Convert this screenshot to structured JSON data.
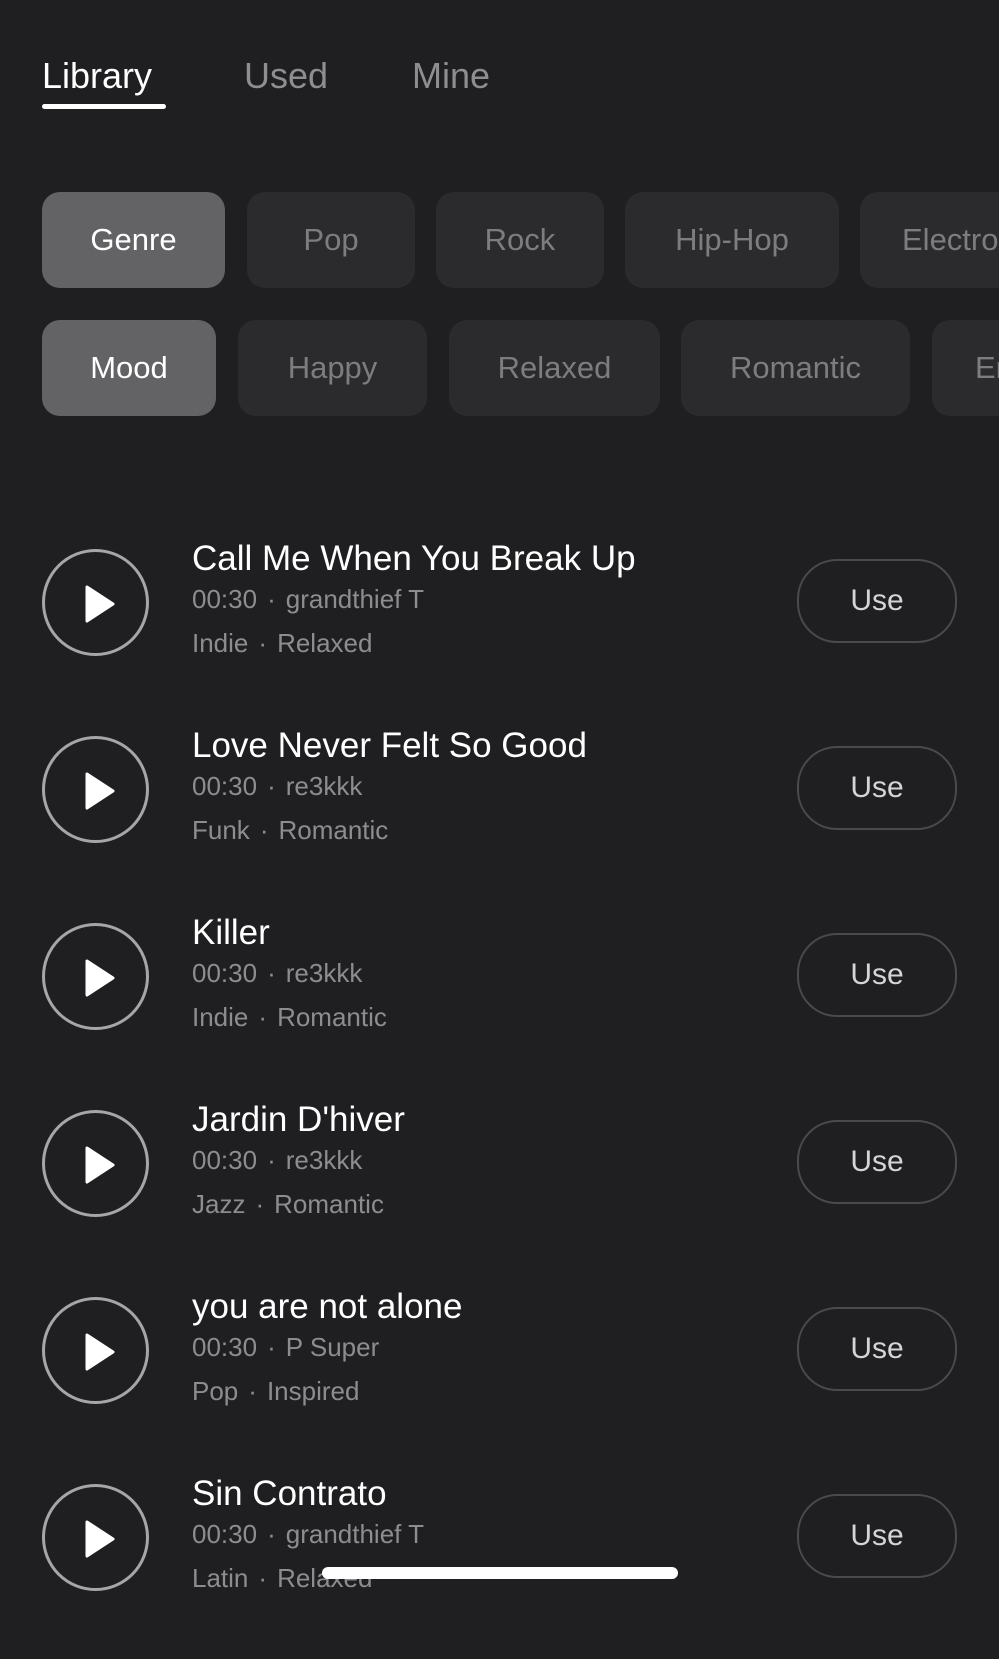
{
  "tabs": [
    {
      "label": "Library",
      "active": true
    },
    {
      "label": "Used",
      "active": false
    },
    {
      "label": "Mine",
      "active": false
    }
  ],
  "filters": {
    "genre": {
      "label": "Genre",
      "options": [
        "Pop",
        "Rock",
        "Hip-Hop",
        "Electro"
      ]
    },
    "mood": {
      "label": "Mood",
      "options": [
        "Happy",
        "Relaxed",
        "Romantic",
        "En"
      ]
    }
  },
  "songs": [
    {
      "title": "Call Me When You Break Up",
      "duration": "00:30",
      "artist": "grandthief T",
      "genre": "Indie",
      "mood": "Relaxed",
      "action": "Use"
    },
    {
      "title": "Love Never Felt So Good",
      "duration": "00:30",
      "artist": "re3kkk",
      "genre": "Funk",
      "mood": "Romantic",
      "action": "Use"
    },
    {
      "title": "Killer",
      "duration": "00:30",
      "artist": "re3kkk",
      "genre": "Indie",
      "mood": "Romantic",
      "action": "Use"
    },
    {
      "title": "Jardin D'hiver",
      "duration": "00:30",
      "artist": "re3kkk",
      "genre": "Jazz",
      "mood": "Romantic",
      "action": "Use"
    },
    {
      "title": "you are not alone",
      "duration": "00:30",
      "artist": "P Super",
      "genre": "Pop",
      "mood": "Inspired",
      "action": "Use"
    },
    {
      "title": "Sin Contrato",
      "duration": "00:30",
      "artist": "grandthief T",
      "genre": "Latin",
      "mood": "Relaxed",
      "action": "Use"
    }
  ],
  "meta_separator": "·",
  "colors": {
    "background": "#1f1f21",
    "chip": "#2b2b2d",
    "chip_label": "#636365",
    "text_primary": "#ffffff",
    "text_secondary": "#8d8d90"
  },
  "icons": {
    "play": "play-icon"
  }
}
